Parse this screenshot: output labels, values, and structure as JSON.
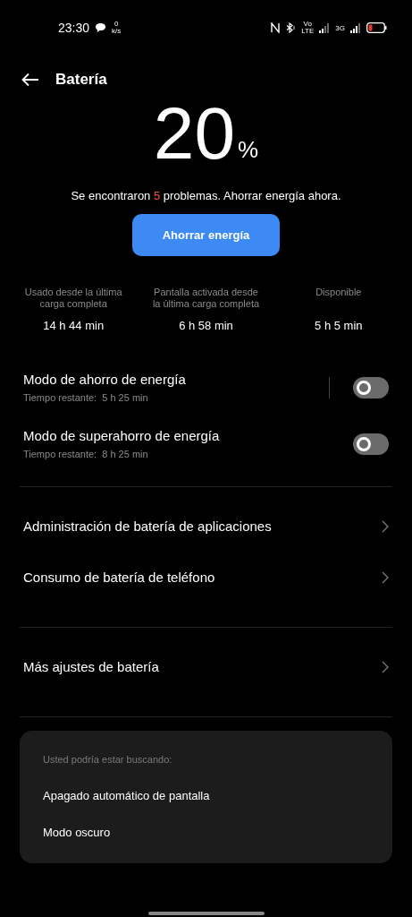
{
  "status_bar": {
    "time": "23:30",
    "speed_value": "0",
    "speed_unit": "k/s",
    "volte_top": "Vo",
    "volte_bottom": "LTE",
    "network": "3G"
  },
  "header": {
    "title": "Batería"
  },
  "battery": {
    "percent": "20",
    "unit": "%"
  },
  "problems": {
    "prefix": "Se encontraron ",
    "count": "5",
    "suffix": " problemas. Ahorrar energía ahora."
  },
  "save_button": "Ahorrar energía",
  "stats": [
    {
      "label": "Usado desde la última carga completa",
      "value": "14 h 44 min"
    },
    {
      "label": "Pantalla activada desde la última carga completa",
      "value": "6 h 58 min"
    },
    {
      "label": "Disponible",
      "value": "5 h 5 min"
    }
  ],
  "modes": [
    {
      "title": "Modo de ahorro de energía",
      "subtitle": "Tiempo restante:  5 h 25 min",
      "on": false,
      "separator": true
    },
    {
      "title": "Modo de superahorro de energía",
      "subtitle": "Tiempo restante:  8 h 25 min",
      "on": false,
      "separator": false
    }
  ],
  "menu_groups": [
    [
      "Administración de batería de aplicaciones",
      "Consumo de batería de teléfono"
    ],
    [
      "Más ajustes de batería"
    ]
  ],
  "suggestions": {
    "heading": "Usted podría estar buscando:",
    "items": [
      "Apagado automático de pantalla",
      "Modo oscuro"
    ]
  }
}
